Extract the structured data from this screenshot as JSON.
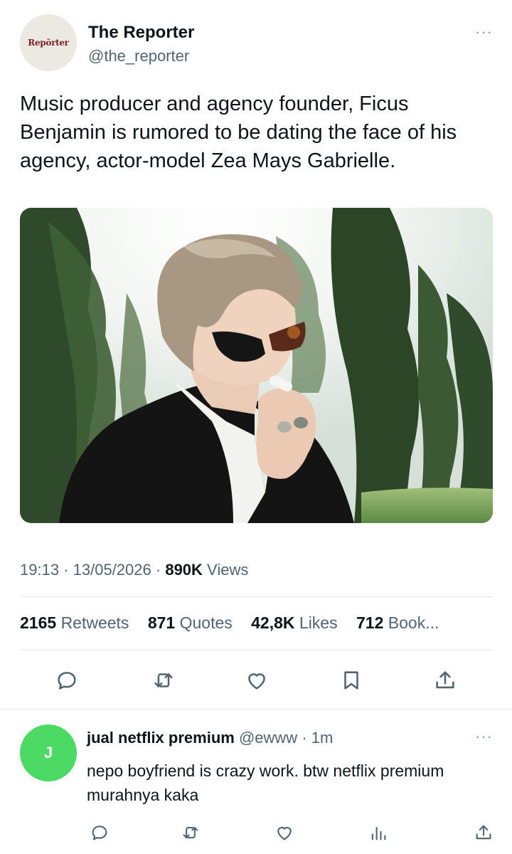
{
  "tweet": {
    "avatar_text": "Repōrter",
    "display_name": "The Reporter",
    "handle": "@the_reporter",
    "more_label": "···",
    "text": "Music producer and agency founder, Ficus Benjamin is rumored to be dating the face of his agency, actor-model Zea Mays Gabrielle.",
    "time": "19:13",
    "date": "13/05/2026",
    "views_count": "890K",
    "views_label": "Views",
    "separator": "·",
    "stats": {
      "retweets_count": "2165",
      "retweets_label": "Retweets",
      "quotes_count": "871",
      "quotes_label": "Quotes",
      "likes_count": "42,8K",
      "likes_label": "Likes",
      "bookmarks_count": "712",
      "bookmarks_label": "Book..."
    },
    "actions": [
      "reply-icon",
      "retweet-icon",
      "like-icon",
      "bookmark-icon",
      "share-icon"
    ]
  },
  "reply": {
    "avatar_letter": "J",
    "display_name": "jual netflix premium",
    "handle": "@ewww",
    "time": "1m",
    "more_label": "···",
    "text": "nepo boyfriend is crazy work. btw netflix premium murahnya kaka",
    "actions": [
      "reply-icon",
      "retweet-icon",
      "like-icon",
      "views-icon",
      "share-icon"
    ]
  },
  "colors": {
    "text": "#0f1419",
    "secondary": "#536471",
    "divider": "#e6e9ec",
    "reply_avatar": "#4cd964"
  }
}
